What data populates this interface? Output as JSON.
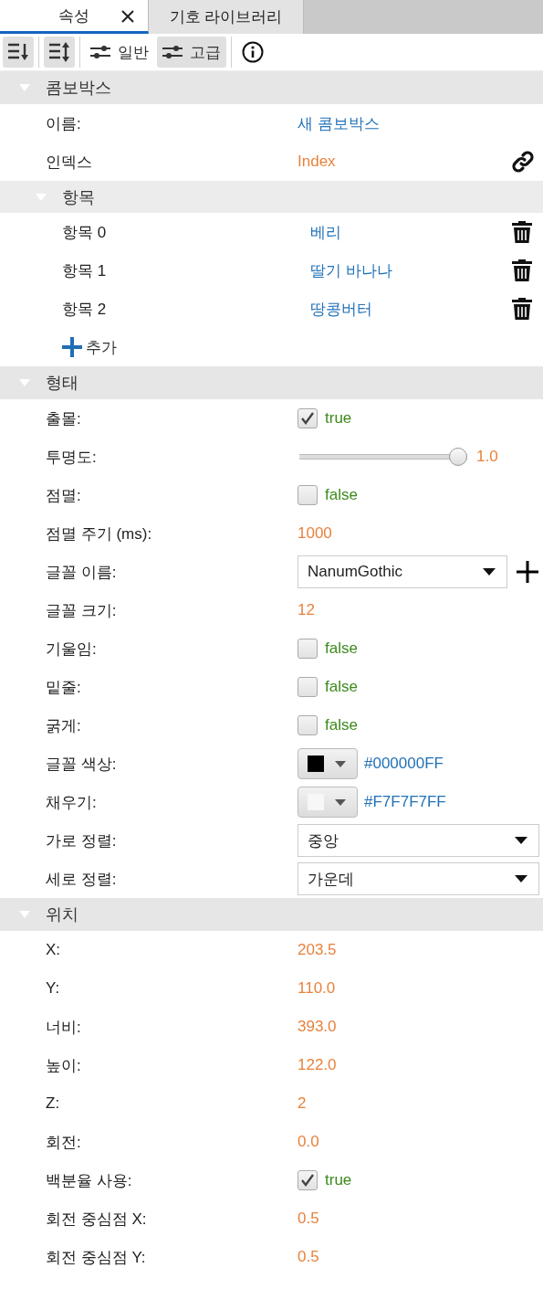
{
  "tabs": [
    {
      "label": "속성",
      "selected": true,
      "closable": true
    },
    {
      "label": "기호 라이브러리",
      "selected": false,
      "closable": false
    }
  ],
  "toolbar": [
    {
      "kind": "sort-down"
    },
    {
      "kind": "sort-updown"
    },
    {
      "kind": "mode",
      "label": "일반",
      "selected": false
    },
    {
      "kind": "mode",
      "label": "고급",
      "selected": true
    },
    {
      "kind": "info"
    }
  ],
  "sections": [
    {
      "title": "콤보박스",
      "expanded": true,
      "rows": [
        {
          "kind": "text",
          "label": "이름:",
          "value": "새 콤보박스"
        },
        {
          "kind": "binding",
          "label": "인덱스",
          "value": "Index"
        },
        {
          "kind": "group",
          "title": "항목",
          "expanded": true,
          "add_label": "추가",
          "children": [
            {
              "label": "항목 0",
              "value": "베리",
              "removable": true
            },
            {
              "label": "항목 1",
              "value": "딸기 바나나",
              "removable": true
            },
            {
              "label": "항목 2",
              "value": "땅콩버터",
              "removable": true
            }
          ]
        }
      ]
    },
    {
      "title": "형태",
      "expanded": true,
      "rows": [
        {
          "kind": "checkbox",
          "label": "출몰:",
          "checked": true,
          "value": "true"
        },
        {
          "kind": "slider",
          "label": "투명도:",
          "level": 1.0,
          "reading": "1.0"
        },
        {
          "kind": "checkbox",
          "label": "점멸:",
          "checked": false,
          "value": "false"
        },
        {
          "kind": "number",
          "label": "점멸 주기 (ms):",
          "value": "1000"
        },
        {
          "kind": "font",
          "label": "글꼴 이름:",
          "value": "NanumGothic"
        },
        {
          "kind": "number",
          "label": "글꼴 크기:",
          "value": "12"
        },
        {
          "kind": "checkbox",
          "label": "기울임:",
          "checked": false,
          "value": "false"
        },
        {
          "kind": "checkbox",
          "label": "밑줄:",
          "checked": false,
          "value": "false"
        },
        {
          "kind": "checkbox",
          "label": "굵게:",
          "checked": false,
          "value": "false"
        },
        {
          "kind": "color",
          "label": "글꼴 색상:",
          "color": "#000000",
          "value": "#000000FF"
        },
        {
          "kind": "color",
          "label": "채우기:",
          "color": "#f7f7f7",
          "value": "#F7F7F7FF"
        },
        {
          "kind": "select",
          "label": "가로 정렬:",
          "value": "중앙"
        },
        {
          "kind": "select",
          "label": "세로 정렬:",
          "value": "가운데"
        }
      ]
    },
    {
      "title": "위치",
      "expanded": true,
      "rows": [
        {
          "kind": "number",
          "label": "X:",
          "value": "203.5"
        },
        {
          "kind": "number",
          "label": "Y:",
          "value": "110.0"
        },
        {
          "kind": "number",
          "label": "너비:",
          "value": "393.0"
        },
        {
          "kind": "number",
          "label": "높이:",
          "value": "122.0"
        },
        {
          "kind": "number",
          "label": "Z:",
          "value": "2"
        },
        {
          "kind": "number",
          "label": "회전:",
          "value": "0.0"
        },
        {
          "kind": "checkbox",
          "label": "백분율 사용:",
          "checked": true,
          "value": "true"
        },
        {
          "kind": "number",
          "label": "회전 중심점 X:",
          "value": "0.5"
        },
        {
          "kind": "number",
          "label": "회전 중심점 Y:",
          "value": "0.5"
        }
      ]
    }
  ]
}
